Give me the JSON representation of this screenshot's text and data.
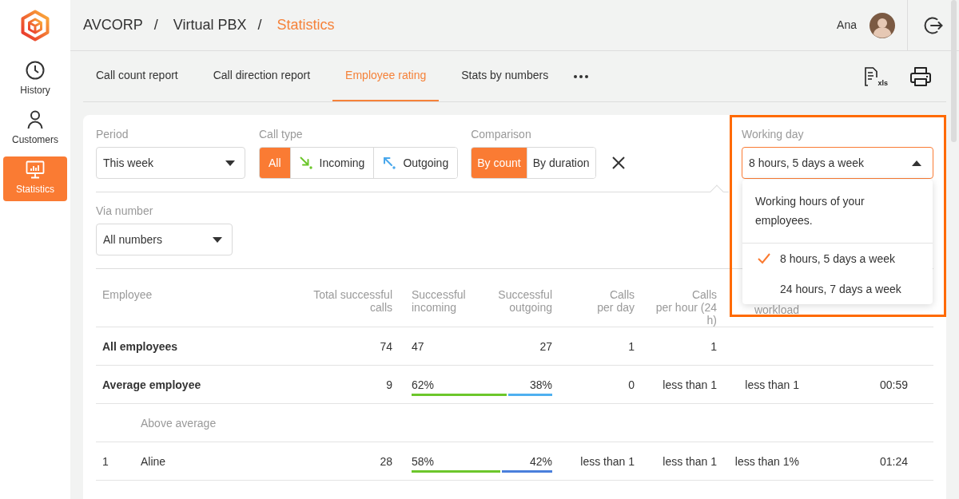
{
  "sidebar": {
    "items": [
      {
        "label": "History",
        "selected": false
      },
      {
        "label": "Customers",
        "selected": false
      },
      {
        "label": "Statistics",
        "selected": true
      }
    ]
  },
  "header": {
    "breadcrumb": [
      {
        "label": "AVCORP",
        "current": false
      },
      {
        "label": "Virtual PBX",
        "current": false
      },
      {
        "label": "Statistics",
        "current": true
      }
    ],
    "separators": [
      "/",
      "/"
    ],
    "user": {
      "name": "Ana"
    }
  },
  "toolbar": {
    "tabs": [
      {
        "label": "Call count report",
        "selected": false
      },
      {
        "label": "Call direction report",
        "selected": false
      },
      {
        "label": "Employee rating",
        "selected": true
      },
      {
        "label": "Stats by numbers",
        "selected": false
      }
    ],
    "export_label": "xls"
  },
  "filters": {
    "period": {
      "label": "Period",
      "value": "This week"
    },
    "call_type": {
      "label": "Call type",
      "options": [
        {
          "label": "All",
          "kind": "plain",
          "selected": true
        },
        {
          "label": "Incoming",
          "kind": "incoming",
          "selected": false
        },
        {
          "label": "Outgoing",
          "kind": "outgoing",
          "selected": false
        }
      ]
    },
    "comparison": {
      "label": "Comparison",
      "options": [
        {
          "label": "By count",
          "selected": true
        },
        {
          "label": "By duration",
          "selected": false
        }
      ]
    },
    "working_day": {
      "label": "Working day",
      "value": "8 hours, 5 days a week",
      "expanded": true,
      "highlighted": true,
      "description": "Working hours of your employees.",
      "options": [
        {
          "label": "8 hours, 5 days a week",
          "selected": true
        },
        {
          "label": "24 hours, 7 days a week",
          "selected": false
        }
      ]
    },
    "via_number": {
      "label": "Via number",
      "value": "All numbers"
    }
  },
  "table": {
    "columns": [
      "Employee",
      "Total successful calls",
      "Successful incoming",
      "Successful outgoing",
      "Calls\nper day",
      "Calls\nper hour (24 h)",
      "workload"
    ],
    "rows": [
      {
        "kind": "summary",
        "name": "All employees",
        "total": "74",
        "incoming": "47",
        "outgoing": "27",
        "per_day": "1",
        "per_hour": "1"
      },
      {
        "kind": "summary",
        "name": "Average employee",
        "total": "9",
        "incoming": "62%",
        "outgoing": "38%",
        "level": 0.69,
        "color": "#4fb0f0",
        "per_day": "0",
        "per_hour": "less than 1",
        "workload": "less than 1",
        "column_8": "00:59"
      },
      {
        "kind": "group",
        "name": "Above average"
      },
      {
        "kind": "employee",
        "rank": "1",
        "name": "Aline",
        "total": "28",
        "incoming": "58%",
        "outgoing": "42%",
        "level": 0.64,
        "color": "#4a7fdc",
        "per_day": "less than 1",
        "per_hour": "less than 1",
        "workload": "less than 1%",
        "column_8": "01:24"
      }
    ]
  }
}
